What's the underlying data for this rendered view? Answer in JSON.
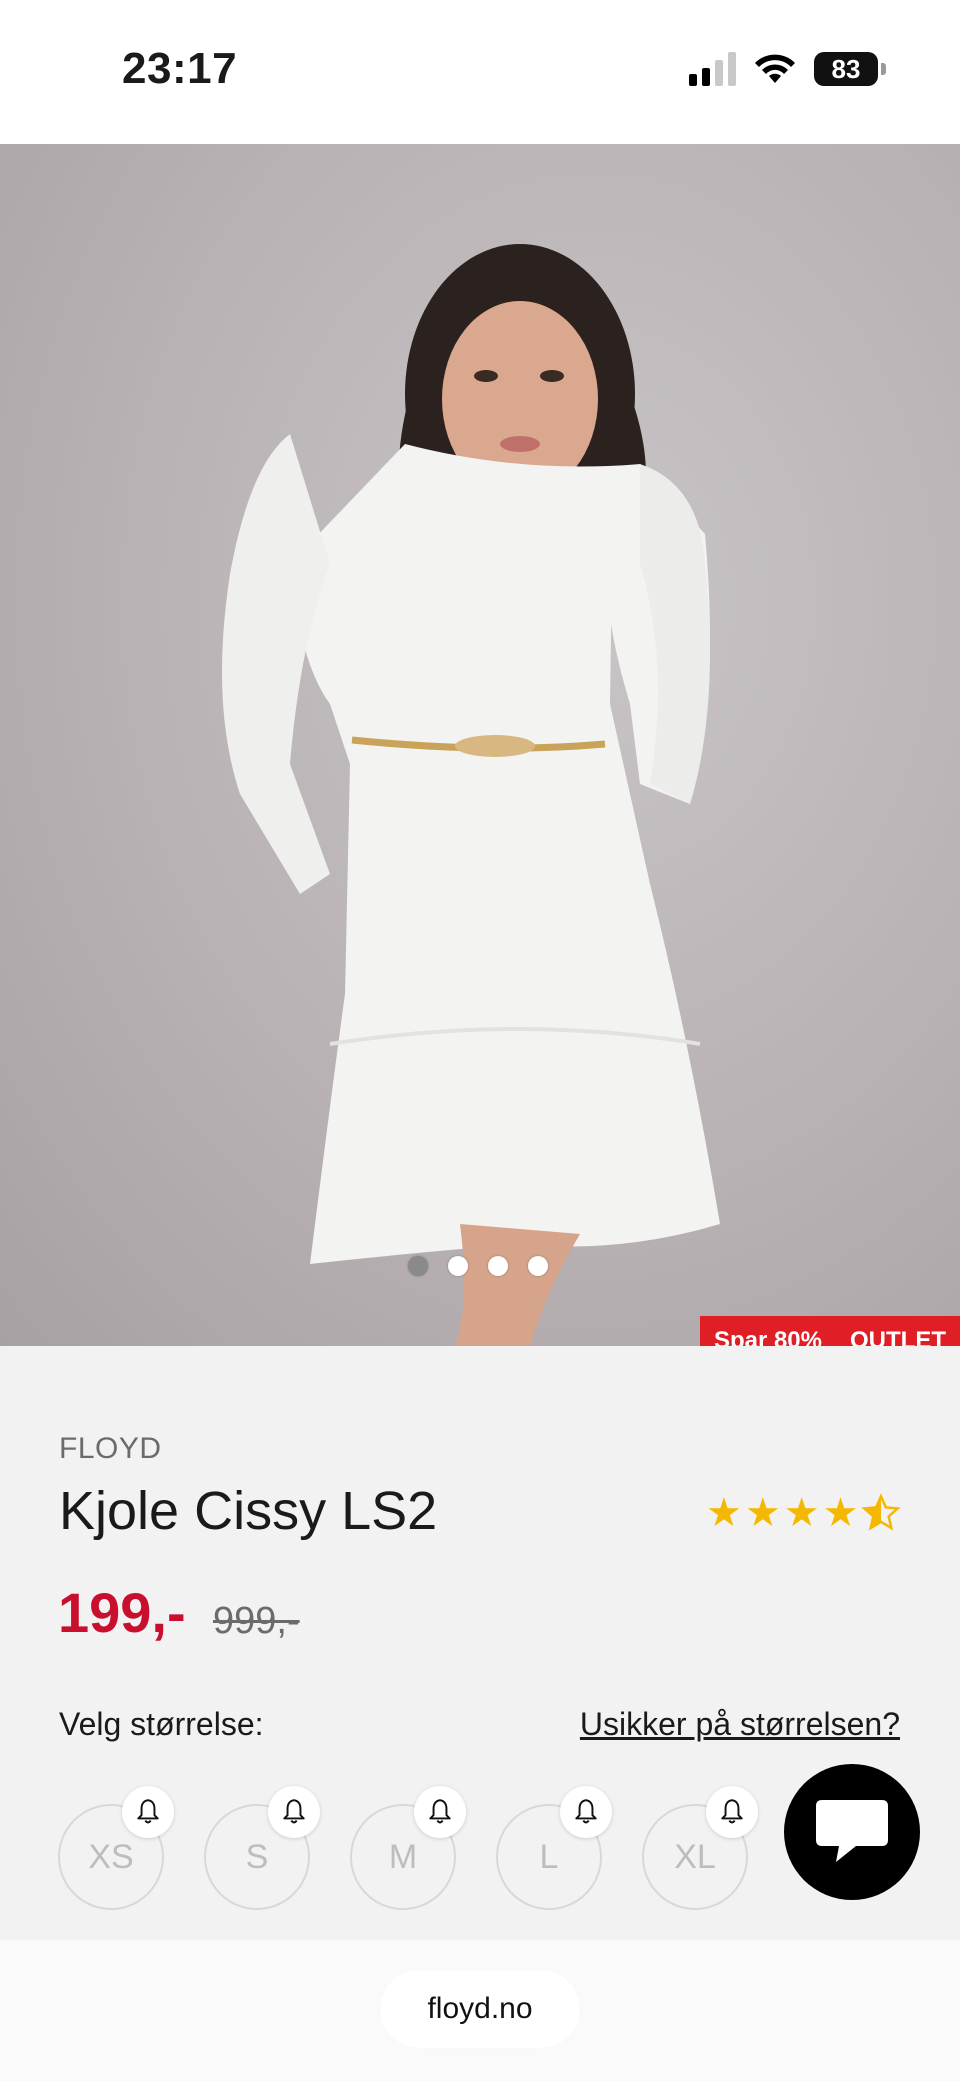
{
  "status_bar": {
    "time": "23:17",
    "battery": "83"
  },
  "product": {
    "image_dots": 4,
    "active_dot": 0,
    "badges": [
      "Spar 80%",
      "OUTLET"
    ],
    "brand": "FLOYD",
    "title": "Kjole Cissy LS2",
    "rating": 4.5,
    "price_now": "199,-",
    "price_was": "999,-"
  },
  "sizes": {
    "label": "Velg størrelse:",
    "help_link": "Usikker på størrelsen?",
    "options": [
      "XS",
      "S",
      "M",
      "L",
      "XL"
    ]
  },
  "browser": {
    "url": "floyd.no"
  },
  "colors": {
    "sale_red": "#c8102e",
    "badge_red": "#e01e26",
    "star": "#f5b800"
  },
  "icons": {
    "bell": "bell-icon",
    "chat": "chat-icon",
    "wifi": "wifi-icon",
    "signal": "signal-icon",
    "battery": "battery-icon"
  }
}
